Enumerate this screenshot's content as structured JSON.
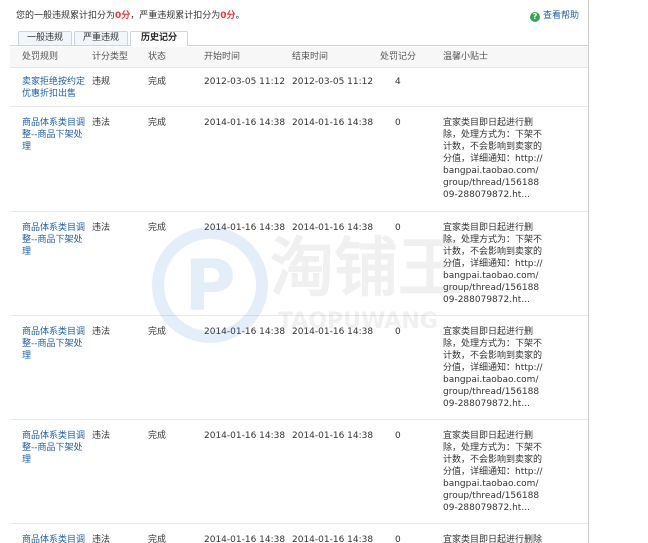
{
  "summary": {
    "prefix": "您的一般违规累计扣分为",
    "general_points": "0分",
    "middle": "，严重违规累计扣分为",
    "serious_points": "0分",
    "suffix": "。"
  },
  "help": {
    "label": "查看帮助",
    "icon": "question-circle-icon"
  },
  "tabs": [
    {
      "label": "一般违规",
      "active": false
    },
    {
      "label": "严重违规",
      "active": false
    },
    {
      "label": "历史记分",
      "active": true
    }
  ],
  "columns": [
    "处罚规则",
    "计分类型",
    "状态",
    "开始时间",
    "结束时间",
    "处罚记分",
    "温馨小贴士"
  ],
  "rows": [
    {
      "rule": "卖家拒绝按约定优惠折扣出售",
      "type": "违规",
      "status": "完成",
      "start": "2012-03-05 11:12",
      "end": "2012-03-05 11:12",
      "points": "4",
      "tip": ""
    },
    {
      "rule": "商品体系类目调整--商品下架处理",
      "type": "违法",
      "status": "完成",
      "start": "2014-01-16 14:38",
      "end": "2014-01-16 14:38",
      "points": "0",
      "tip": "宜家类目即日起进行删除，处理方式为：下架不计数，不会影响到卖家的分值，详细通知：http://bangpai.taobao.com/group/thread/15618809-288079872.ht..."
    },
    {
      "rule": "商品体系类目调整--商品下架处理",
      "type": "违法",
      "status": "完成",
      "start": "2014-01-16 14:38",
      "end": "2014-01-16 14:38",
      "points": "0",
      "tip": "宜家类目即日起进行删除，处理方式为：下架不计数，不会影响到卖家的分值，详细通知：http://bangpai.taobao.com/group/thread/15618809-288079872.ht..."
    },
    {
      "rule": "商品体系类目调整--商品下架处理",
      "type": "违法",
      "status": "完成",
      "start": "2014-01-16 14:38",
      "end": "2014-01-16 14:38",
      "points": "0",
      "tip": "宜家类目即日起进行删除，处理方式为：下架不计数，不会影响到卖家的分值，详细通知：http://bangpai.taobao.com/group/thread/15618809-288079872.ht..."
    },
    {
      "rule": "商品体系类目调整--商品下架处理",
      "type": "违法",
      "status": "完成",
      "start": "2014-01-16 14:38",
      "end": "2014-01-16 14:38",
      "points": "0",
      "tip": "宜家类目即日起进行删除，处理方式为：下架不计数，不会影响到卖家的分值，详细通知：http://bangpai.taobao.com/group/thread/15618809-288079872.ht..."
    },
    {
      "rule": "商品体系类目调整--商品下架处理",
      "type": "违法",
      "status": "完成",
      "start": "2014-01-16 14:38",
      "end": "2014-01-16 14:38",
      "points": "0",
      "tip": "宜家类目即日起进行删除"
    }
  ],
  "watermark": {
    "cn": "淘铺王",
    "en": "TAOPUWANG"
  },
  "colors": {
    "accent_red": "#e4393c",
    "link_blue": "#1f5fa8",
    "help_green": "#34a853"
  }
}
